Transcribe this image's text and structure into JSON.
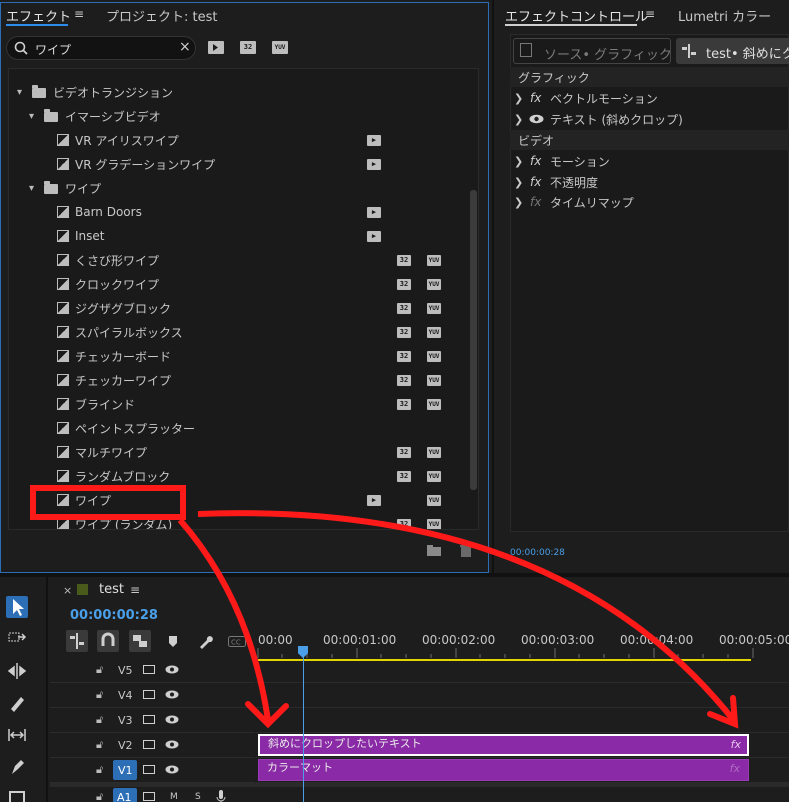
{
  "effects_panel": {
    "tab_effects": "エフェクト",
    "menu_glyph": "≡",
    "tab_project": "プロジェクト: test",
    "search": {
      "value": "ワイプ",
      "clear": "×"
    },
    "filter_badges": [
      "32",
      "YUV"
    ],
    "tree": [
      {
        "kind": "folder",
        "level": 0,
        "label": "ビデオトランジション",
        "expanded": true
      },
      {
        "kind": "folder",
        "level": 1,
        "label": "イマーシブビデオ",
        "expanded": true
      },
      {
        "kind": "item",
        "label": "VR アイリスワイプ",
        "badges": [
          "accel"
        ]
      },
      {
        "kind": "item",
        "label": "VR グラデーションワイプ",
        "badges": [
          "accel"
        ]
      },
      {
        "kind": "folder",
        "level": 1,
        "label": "ワイプ",
        "expanded": true
      },
      {
        "kind": "item",
        "label": "Barn Doors",
        "badges": [
          "accel"
        ]
      },
      {
        "kind": "item",
        "label": "Inset",
        "badges": [
          "accel"
        ]
      },
      {
        "kind": "item",
        "label": "くさび形ワイプ",
        "badges": [
          "32",
          "YUV"
        ]
      },
      {
        "kind": "item",
        "label": "クロックワイプ",
        "badges": [
          "32",
          "YUV"
        ]
      },
      {
        "kind": "item",
        "label": "ジグザグブロック",
        "badges": [
          "32",
          "YUV"
        ]
      },
      {
        "kind": "item",
        "label": "スパイラルボックス",
        "badges": [
          "32",
          "YUV"
        ]
      },
      {
        "kind": "item",
        "label": "チェッカーボード",
        "badges": [
          "32",
          "YUV"
        ]
      },
      {
        "kind": "item",
        "label": "チェッカーワイプ",
        "badges": [
          "32",
          "YUV"
        ]
      },
      {
        "kind": "item",
        "label": "ブラインド",
        "badges": [
          "32",
          "YUV"
        ]
      },
      {
        "kind": "item",
        "label": "ペイントスプラッター",
        "badges": []
      },
      {
        "kind": "item",
        "label": "マルチワイプ",
        "badges": [
          "32",
          "YUV"
        ]
      },
      {
        "kind": "item",
        "label": "ランダムブロック",
        "badges": [
          "32",
          "YUV"
        ]
      },
      {
        "kind": "item",
        "label": "ワイプ",
        "badges": [
          "accel",
          "YUV"
        ],
        "highlighted": true
      },
      {
        "kind": "item",
        "label": "ワイプ (ランダム)",
        "badges": [
          "32",
          "YUV"
        ]
      }
    ]
  },
  "effect_controls": {
    "tab_effect_controls": "エフェクトコントロール",
    "menu_glyph": "≡",
    "tab_lumetri": "Lumetri カラー",
    "source_tab": "ソース• グラフィック",
    "clip_tab": "test• 斜めにクロ",
    "section_graphic": "グラフィック",
    "graphic_rows": [
      "ベクトルモーション",
      "テキスト (斜めクロップ)"
    ],
    "section_video": "ビデオ",
    "video_rows": [
      "モーション",
      "不透明度",
      "タイムリマップ"
    ],
    "fx_symbol": "fx",
    "timecode": "00:00:00:28"
  },
  "timeline": {
    "sequence_name": "test",
    "close_glyph": "×",
    "menu_glyph": "≡",
    "timecode": "00:00:00:28",
    "ruler": [
      "00:00",
      "00:00:01:00",
      "00:00:02:00",
      "00:00:03:00",
      "00:00:04:00",
      "00:00:05:00"
    ],
    "tracks": [
      "V5",
      "V4",
      "V3",
      "V2",
      "V1",
      "A1"
    ],
    "a1_toggles": [
      "M",
      "S"
    ],
    "clips": [
      {
        "track": "V2",
        "label": "斜めにクロップしたいテキスト",
        "fx": "fx"
      },
      {
        "track": "V1",
        "label": "カラーマット",
        "fx": "fx"
      }
    ],
    "accent_color": "#2d8ceb",
    "clip_color": "#8a2aa6"
  },
  "annotation": {
    "color": "#ff1a1a"
  }
}
